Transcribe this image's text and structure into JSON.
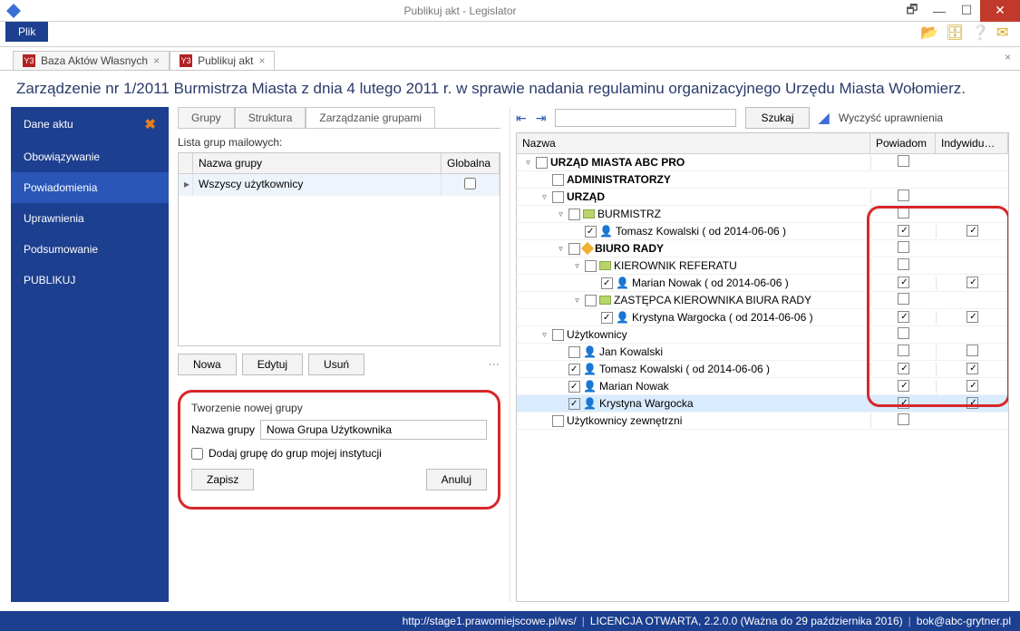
{
  "window": {
    "title": "Publikuj akt - Legislator"
  },
  "menu": {
    "plik": "Plik"
  },
  "doc_tabs": [
    {
      "label": "Baza Aktów Własnych",
      "active": false
    },
    {
      "label": "Publikuj akt",
      "active": true
    }
  ],
  "heading": "Zarządzenie nr 1/2011 Burmistrza Miasta z dnia 4 lutego 2011 r. w sprawie nadania regulaminu organizacyjnego Urzędu Miasta Wołomierz.",
  "sidebar": {
    "items": [
      {
        "label": "Dane aktu",
        "close": true
      },
      {
        "label": "Obowiązywanie"
      },
      {
        "label": "Powiadomienia",
        "active": true
      },
      {
        "label": "Uprawnienia"
      },
      {
        "label": "Podsumowanie"
      },
      {
        "label": "PUBLIKUJ"
      }
    ]
  },
  "subtabs": [
    {
      "label": "Grupy"
    },
    {
      "label": "Struktura"
    },
    {
      "label": "Zarządzanie grupami",
      "active": true
    }
  ],
  "maillist": {
    "title": "Lista grup mailowych:",
    "cols": {
      "name": "Nazwa grupy",
      "global": "Globalna"
    },
    "rows": [
      {
        "name": "Wszyscy użytkownicy",
        "global": false
      }
    ]
  },
  "group_buttons": {
    "new": "Nowa",
    "edit": "Edytuj",
    "del": "Usuń"
  },
  "newgroup": {
    "title": "Tworzenie nowej grupy",
    "name_label": "Nazwa grupy",
    "name_value": "Nowa Grupa Użytkownika",
    "add_to_inst": "Dodaj grupę do grup mojej instytucji",
    "save": "Zapisz",
    "cancel": "Anuluj"
  },
  "treetools": {
    "search_btn": "Szukaj",
    "clear_perms": "Wyczyść uprawnienia"
  },
  "tree_header": {
    "name": "Nazwa",
    "notify": "Powiadom",
    "indiv": "Indywidu…"
  },
  "tree": [
    {
      "lvl": 0,
      "exp": "▿",
      "chk": false,
      "bold": true,
      "name": "URZĄD MIASTA ABC PRO",
      "notify": false,
      "indiv": null
    },
    {
      "lvl": 1,
      "exp": null,
      "chk": false,
      "bold": true,
      "name": "ADMINISTRATORZY",
      "notify": null,
      "indiv": null
    },
    {
      "lvl": 1,
      "exp": "▿",
      "chk": false,
      "bold": true,
      "name": "URZĄD",
      "notify": false,
      "indiv": null
    },
    {
      "lvl": 2,
      "exp": "▿",
      "chk": false,
      "icon": "folder",
      "name": "BURMISTRZ",
      "notify": false,
      "indiv": null
    },
    {
      "lvl": 3,
      "exp": null,
      "chk": true,
      "icon": "person",
      "name": "Tomasz Kowalski ( od 2014-06-06 )",
      "notify": true,
      "indiv": true
    },
    {
      "lvl": 2,
      "exp": "▿",
      "chk": false,
      "icon": "diamond",
      "bold": true,
      "name": "BIURO RADY",
      "notify": false,
      "indiv": null
    },
    {
      "lvl": 3,
      "exp": "▿",
      "chk": false,
      "icon": "folder",
      "name": "KIEROWNIK REFERATU",
      "notify": false,
      "indiv": null
    },
    {
      "lvl": 4,
      "exp": null,
      "chk": true,
      "icon": "person",
      "name": "Marian Nowak ( od 2014-06-06 )",
      "notify": true,
      "indiv": true
    },
    {
      "lvl": 3,
      "exp": "▿",
      "chk": false,
      "icon": "folder",
      "name": "ZASTĘPCA KIEROWNIKA BIURA RADY",
      "notify": false,
      "indiv": null
    },
    {
      "lvl": 4,
      "exp": null,
      "chk": true,
      "icon": "person",
      "name": "Krystyna Wargocka ( od 2014-06-06 )",
      "notify": true,
      "indiv": true
    },
    {
      "lvl": 1,
      "exp": "▿",
      "chk": false,
      "name": "Użytkownicy",
      "notify": false,
      "indiv": null
    },
    {
      "lvl": 2,
      "exp": null,
      "chk": false,
      "icon": "person",
      "name": "Jan Kowalski",
      "notify": false,
      "indiv": false
    },
    {
      "lvl": 2,
      "exp": null,
      "chk": true,
      "icon": "person",
      "name": "Tomasz Kowalski ( od 2014-06-06 )",
      "notify": true,
      "indiv": true
    },
    {
      "lvl": 2,
      "exp": null,
      "chk": true,
      "icon": "person",
      "name": "Marian Nowak",
      "notify": true,
      "indiv": true
    },
    {
      "lvl": 2,
      "exp": null,
      "chk": true,
      "icon": "person",
      "name": "Krystyna Wargocka",
      "notify": true,
      "indiv": true,
      "sel": true
    },
    {
      "lvl": 1,
      "exp": null,
      "chk": false,
      "name": "Użytkownicy zewnętrzni",
      "notify": false,
      "indiv": null
    }
  ],
  "statusbar": {
    "url": "http://stage1.prawomiejscowe.pl/ws/",
    "license": "LICENCJA OTWARTA, 2.2.0.0 (Ważna do 29 października 2016)",
    "email": "bok@abc-grytner.pl"
  }
}
